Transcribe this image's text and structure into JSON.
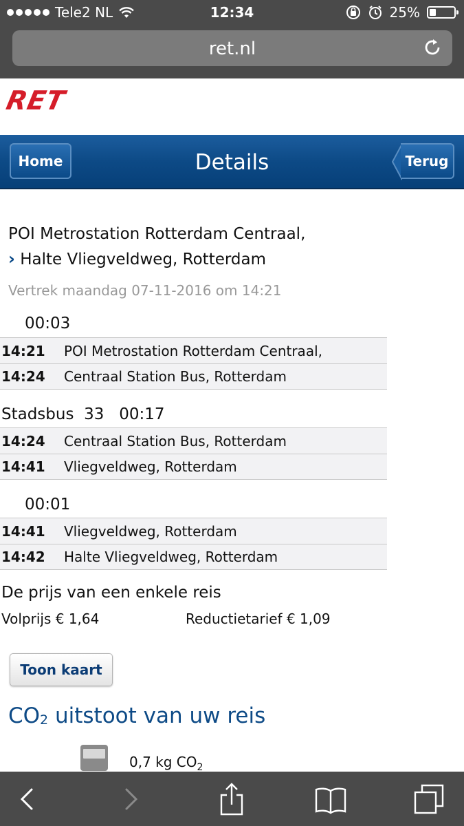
{
  "status_bar": {
    "carrier": "Tele2 NL",
    "time": "12:34",
    "battery": "25%",
    "battery_level": 0.25
  },
  "browser": {
    "url": "ret.nl"
  },
  "header": {
    "logo_text": "RET",
    "title": "Details",
    "home_label": "Home",
    "back_label": "Terug"
  },
  "route": {
    "from": "POI Metrostation Rotterdam Centraal,",
    "to": "Halte Vliegveldweg, Rotterdam",
    "departure": "Vertrek maandag 07-11-2016 om 14:21"
  },
  "legs": [
    {
      "label": "00:03",
      "rows": [
        {
          "time": "14:21",
          "stop": "POI Metrostation Rotterdam Centraal,"
        },
        {
          "time": "14:24",
          "stop": "Centraal Station Bus, Rotterdam"
        }
      ]
    },
    {
      "label": "Stadsbus  33   00:17",
      "rows": [
        {
          "time": "14:24",
          "stop": "Centraal Station Bus, Rotterdam"
        },
        {
          "time": "14:41",
          "stop": "Vliegveldweg, Rotterdam"
        }
      ]
    },
    {
      "label": "00:01",
      "rows": [
        {
          "time": "14:41",
          "stop": "Vliegveldweg, Rotterdam"
        },
        {
          "time": "14:42",
          "stop": "Halte Vliegveldweg, Rotterdam"
        }
      ]
    }
  ],
  "price": {
    "title": "De prijs van een enkele reis",
    "full": "Volprijs € 1,64",
    "reduced": "Reductietarief € 1,09"
  },
  "map_button": "Toon kaart",
  "co2": {
    "title_prefix": "CO",
    "title_sub": "2",
    "title_suffix": " uitstoot van uw reis",
    "value": "0,7 kg CO",
    "value_sub": "2"
  },
  "colors": {
    "brand_red": "#d51d29",
    "nav_blue": "#0d4a86",
    "chrome_gray": "#4a4a4a"
  }
}
